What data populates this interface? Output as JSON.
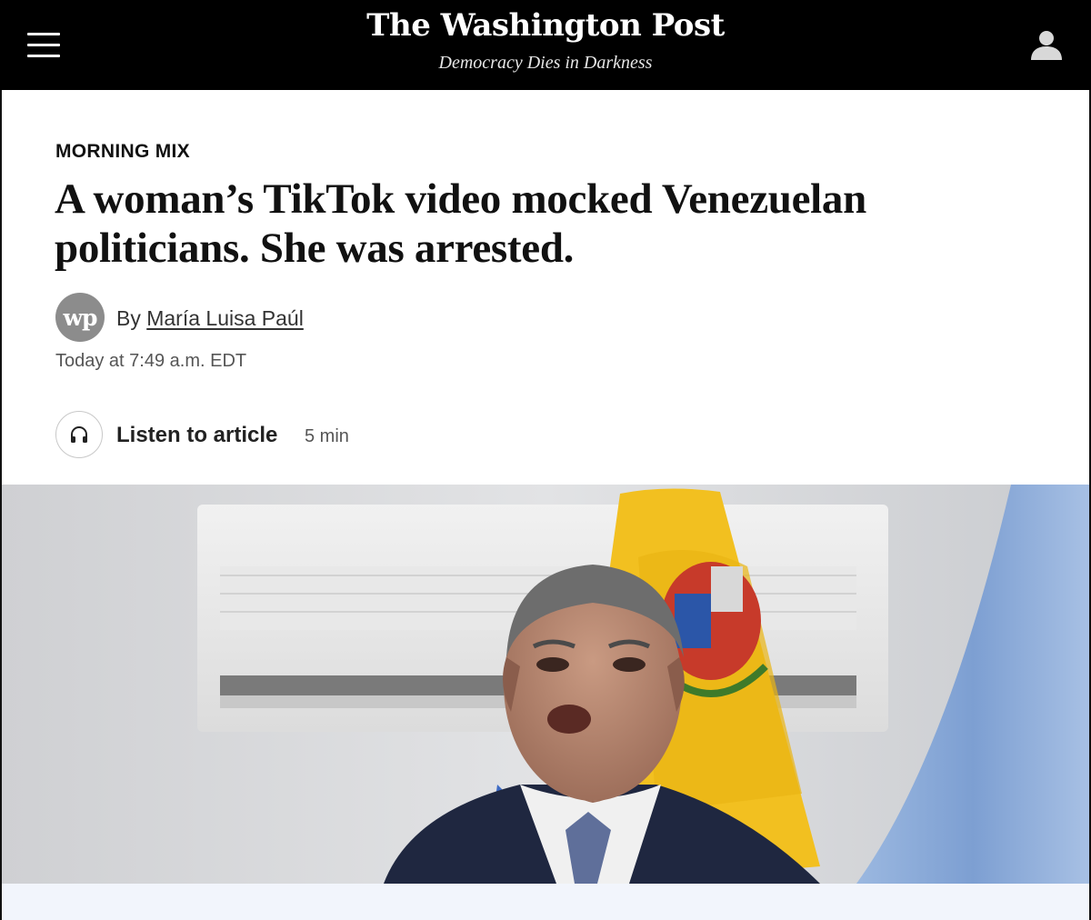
{
  "header": {
    "logo": "The Washington Post",
    "tagline": "Democracy Dies in Darkness",
    "menu_icon": "hamburger-icon",
    "account_icon": "user-icon"
  },
  "article": {
    "kicker": "MORNING MIX",
    "headline": "A woman’s TikTok video mocked Venezuelan politicians. She was arrested.",
    "byline_prefix": "By",
    "author": "María Luisa Paúl",
    "author_avatar_text": "wp",
    "timestamp": "Today at 7:49 a.m. EDT",
    "listen": {
      "icon": "headphones-icon",
      "label": "Listen to article",
      "duration": "5 min"
    }
  },
  "colors": {
    "header_bg": "#000000",
    "flag_yellow": "#f2c020",
    "flag_blue": "#7fa4d6",
    "footer_strip": "#f2f5fc"
  }
}
